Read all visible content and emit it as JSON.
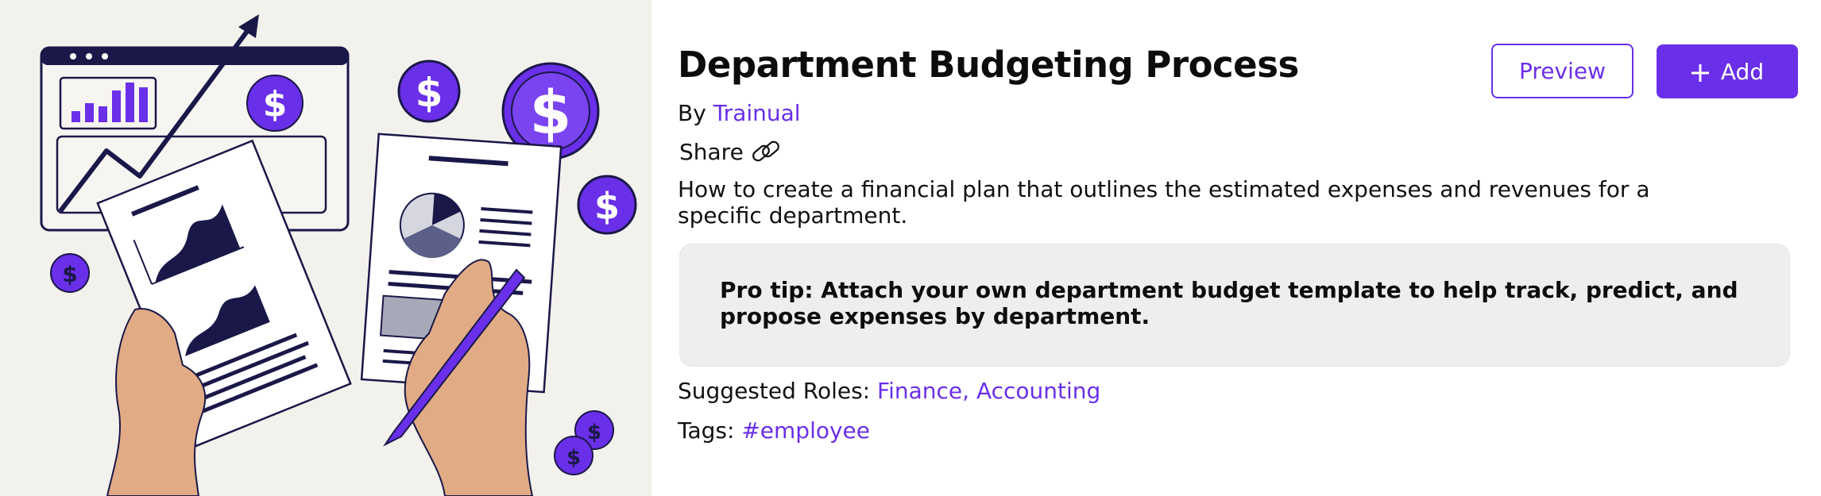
{
  "header": {
    "title": "Department Budgeting Process",
    "by_label": "By",
    "author": "Trainual",
    "share_label": "Share"
  },
  "description": "How to create a financial plan that outlines the estimated expenses and revenues for a specific department.",
  "pro_tip": "Pro tip: Attach your own department budget template to help track, predict, and propose expenses by department.",
  "roles": {
    "label": "Suggested Roles:",
    "value": "Finance, Accounting"
  },
  "tags": {
    "label": "Tags:",
    "value": "#employee"
  },
  "actions": {
    "preview_label": "Preview",
    "add_label": "Add"
  },
  "colors": {
    "accent": "#6a2fe8",
    "navy": "#1a1848",
    "hero_bg": "#f3f1ec",
    "tip_bg": "#eeeeee",
    "skin": "#e1ab85"
  },
  "hero_icons": [
    "browser-window-icon",
    "bar-chart-icon",
    "trend-arrow-icon",
    "dollar-coin-icon",
    "report-document-icon",
    "pie-chart-icon",
    "hand-icon",
    "pen-icon"
  ]
}
